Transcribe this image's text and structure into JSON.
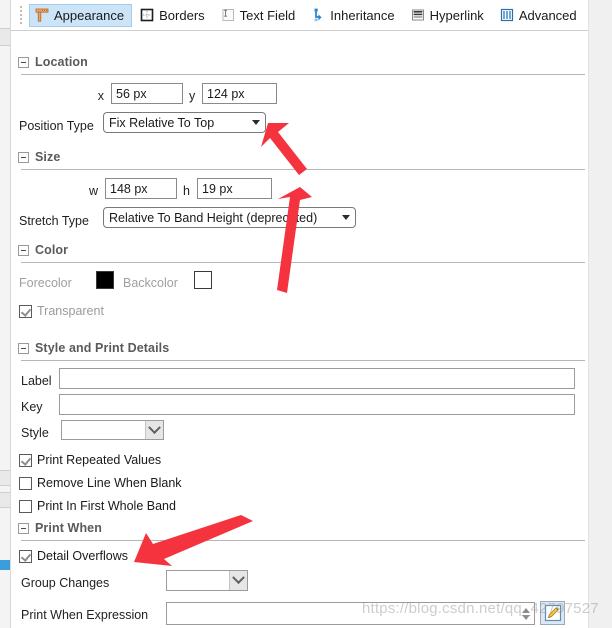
{
  "toolbar": {
    "tabs": [
      {
        "label": "Appearance",
        "icon": "appearance-icon",
        "active": true
      },
      {
        "label": "Borders",
        "icon": "borders-icon",
        "active": false
      },
      {
        "label": "Text Field",
        "icon": "text-field-icon",
        "active": false
      },
      {
        "label": "Inheritance",
        "icon": "inheritance-icon",
        "active": false
      },
      {
        "label": "Hyperlink",
        "icon": "hyperlink-icon",
        "active": false
      },
      {
        "label": "Advanced",
        "icon": "advanced-icon",
        "active": false
      }
    ]
  },
  "sections": {
    "location": {
      "title": "Location",
      "x_label": "x",
      "x_value": "56 px",
      "y_label": "y",
      "y_value": "124 px",
      "position_type_label": "Position Type",
      "position_type_value": "Fix Relative To Top"
    },
    "size": {
      "title": "Size",
      "w_label": "w",
      "w_value": "148 px",
      "h_label": "h",
      "h_value": "19 px",
      "stretch_type_label": "Stretch Type",
      "stretch_type_value": "Relative To Band Height (deprecated)"
    },
    "color": {
      "title": "Color",
      "forecolor_label": "Forecolor",
      "forecolor_value": "#000000",
      "backcolor_label": "Backcolor",
      "backcolor_value": "#ffffff",
      "transparent_label": "Transparent",
      "transparent_checked": true
    },
    "style_print": {
      "title": "Style and Print Details",
      "label_label": "Label",
      "label_value": "",
      "key_label": "Key",
      "key_value": "",
      "style_label": "Style",
      "style_value": "",
      "checkboxes": [
        {
          "label": "Print Repeated Values",
          "checked": true
        },
        {
          "label": "Remove Line When Blank",
          "checked": false
        },
        {
          "label": "Print In First Whole Band",
          "checked": false
        }
      ]
    },
    "print_when": {
      "title": "Print When",
      "detail_overflows_label": "Detail Overflows",
      "detail_overflows_checked": true,
      "group_changes_label": "Group Changes",
      "group_changes_value": "",
      "print_when_expression_label": "Print When Expression",
      "print_when_expression_value": ""
    }
  },
  "annotations": {
    "arrow_count": 3
  },
  "watermark": {
    "text": "https://blog.csdn.net/qq_42797527"
  },
  "colors": {
    "tab_active_bg": "#cce4f7",
    "tab_active_border": "#a8cdea",
    "section_title": "#5a5a5a",
    "arrow_red": "#f5333f",
    "panel_gray": "#f0f0f0"
  }
}
